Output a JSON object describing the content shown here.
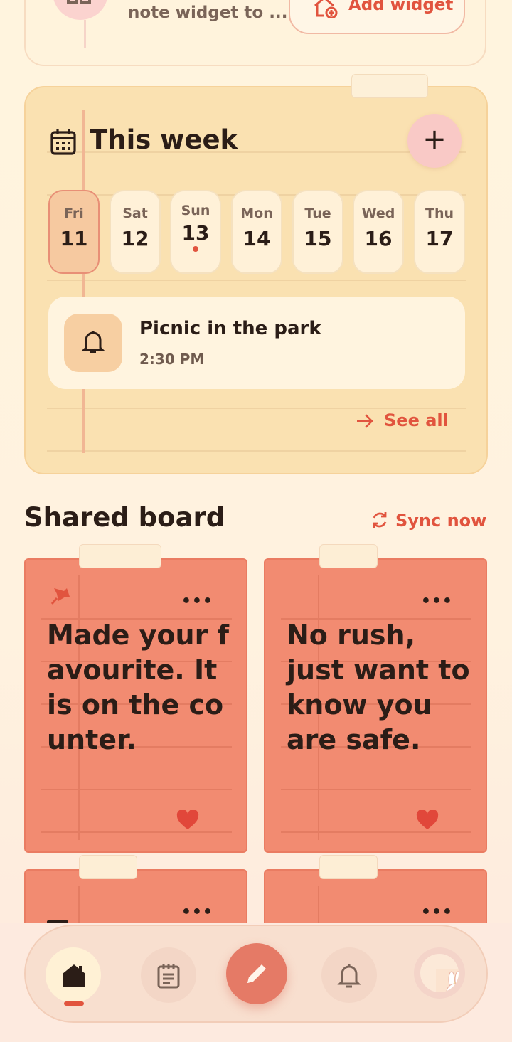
{
  "promo": {
    "text": "Add the quick note widget to ...",
    "button_label": "Add widget"
  },
  "week": {
    "title": "This week",
    "days": [
      {
        "name": "Fri",
        "date": "11",
        "selected": true
      },
      {
        "name": "Sat",
        "date": "12"
      },
      {
        "name": "Sun",
        "date": "13",
        "has_event": true
      },
      {
        "name": "Mon",
        "date": "14"
      },
      {
        "name": "Tue",
        "date": "15"
      },
      {
        "name": "Wed",
        "date": "16"
      },
      {
        "name": "Thu",
        "date": "17"
      }
    ],
    "event": {
      "title": "Picnic in the park",
      "time": "2:30 PM"
    },
    "see_all_label": "See all"
  },
  "board": {
    "title": "Shared board",
    "sync_label": "Sync now",
    "notes": [
      {
        "text": "Made your favourite. It is on the counter.",
        "pinned": true,
        "liked": true
      },
      {
        "text": "No rush, just want to know you are safe.",
        "pinned": false,
        "liked": true
      }
    ]
  },
  "colors": {
    "accent": "#e1543e",
    "note": "#f28b71",
    "week_card": "#fae1b1"
  }
}
